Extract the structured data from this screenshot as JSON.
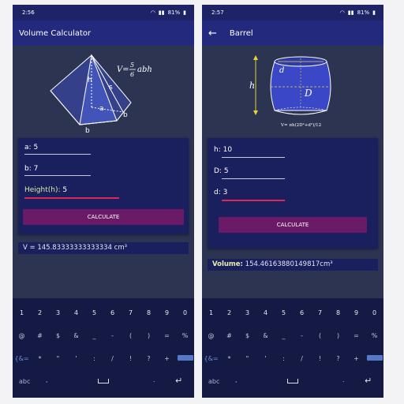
{
  "left_screen": {
    "status": {
      "time": "2:56",
      "battery": "81%"
    },
    "appbar": {
      "title": "Volume Calculator"
    },
    "figure": {
      "formula": "V= 5/6 abh",
      "formula_num": "5",
      "formula_den": "6",
      "formula_v": "V=",
      "formula_rest": "abh",
      "labels": {
        "h": "h",
        "s": "s",
        "a": "a",
        "b1": "b",
        "b2": "b"
      }
    },
    "fields": [
      {
        "label": "a:",
        "value": "5"
      },
      {
        "label": "b:",
        "value": "7"
      },
      {
        "label": "Height(h):",
        "value": "5"
      }
    ],
    "button": "CALCULATE",
    "result": "V = 145.83333333333334 cm³"
  },
  "right_screen": {
    "status": {
      "time": "2:57",
      "battery": "81%"
    },
    "appbar": {
      "title": "Barrel"
    },
    "figure": {
      "labels": {
        "d": "d",
        "D": "D",
        "h": "h"
      },
      "formula": "V= πh(2D²+d²)/12"
    },
    "fields": [
      {
        "label": "h:",
        "value": "10"
      },
      {
        "label": "D:",
        "value": "5"
      },
      {
        "label": "d:",
        "value": "3"
      }
    ],
    "button": "CALCULATE",
    "result_label": "Volume:",
    "result_value": "154.46163880149817cm³"
  },
  "keyboard": {
    "row1": [
      "1",
      "2",
      "3",
      "4",
      "5",
      "6",
      "7",
      "8",
      "9",
      "0"
    ],
    "row2": [
      "@",
      "#",
      "$",
      "&",
      "_",
      "-",
      "(",
      ")",
      "=",
      "%"
    ],
    "row3": [
      "{&=",
      "*",
      "\"",
      "'",
      ":",
      "/",
      "!",
      "?",
      "+"
    ],
    "bottom": {
      "abc": "abc",
      "comma": ",",
      "dot": "."
    }
  },
  "colors": {
    "background": "#2c3452",
    "appbar": "#232a7e",
    "card": "#1a1f5e",
    "button": "#6b1a68",
    "figure_accent": "#e8d432",
    "active_underline": "#e0255c"
  },
  "icons": [
    "back-arrow-icon",
    "wifi-icon",
    "signal-icon",
    "battery-icon",
    "space-key-icon",
    "enter-icon",
    "delete-key-icon"
  ]
}
